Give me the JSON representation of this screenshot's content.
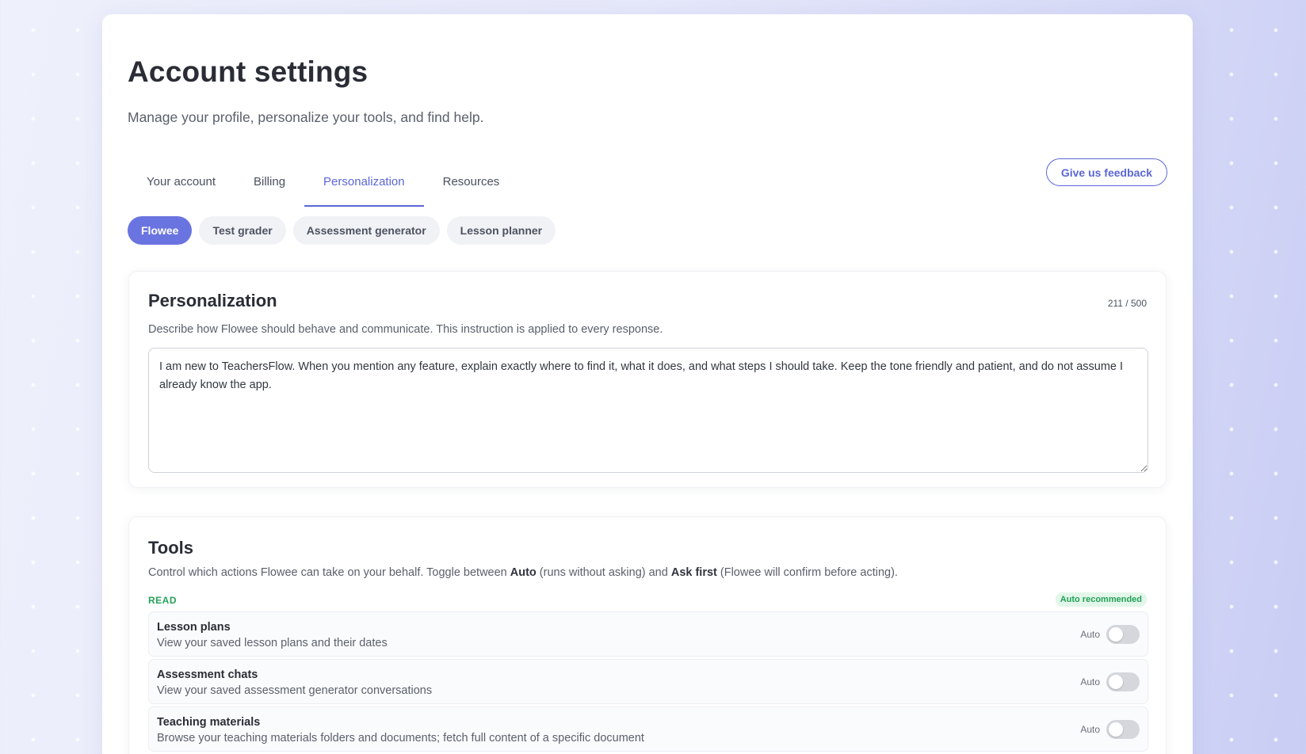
{
  "header": {
    "title": "Account settings",
    "subtitle": "Manage your profile, personalize your tools, and find help."
  },
  "tabs": [
    {
      "label": "Your account",
      "active": false
    },
    {
      "label": "Billing",
      "active": false
    },
    {
      "label": "Personalization",
      "active": true
    },
    {
      "label": "Resources",
      "active": false
    }
  ],
  "feedback_label": "Give us feedback",
  "pills": [
    {
      "label": "Flowee",
      "active": true
    },
    {
      "label": "Test grader",
      "active": false
    },
    {
      "label": "Assessment generator",
      "active": false
    },
    {
      "label": "Lesson planner",
      "active": false
    }
  ],
  "personalization": {
    "title": "Personalization",
    "char_count": "211 / 500",
    "description": "Describe how Flowee should behave and communicate. This instruction is applied to every response.",
    "instruction": "I am new to TeachersFlow. When you mention any feature, explain exactly where to find it, what it does, and what steps I should take. Keep the tone friendly and patient, and do not assume I already know the app."
  },
  "tools": {
    "title": "Tools",
    "desc_part1": "Control which actions Flowee can take on your behalf. Toggle between ",
    "desc_auto": "Auto",
    "desc_part2": " (runs without asking) and ",
    "desc_ask": "Ask first",
    "desc_part3": " (Flowee will confirm before acting).",
    "read_label": "READ",
    "auto_badge": "Auto recommended",
    "items": [
      {
        "name": "Lesson plans",
        "desc": "View your saved lesson plans and their dates",
        "mode": "Auto"
      },
      {
        "name": "Assessment chats",
        "desc": "View your saved assessment generator conversations",
        "mode": "Auto"
      },
      {
        "name": "Teaching materials",
        "desc": "Browse your teaching materials folders and documents; fetch full content of a specific document",
        "mode": "Auto"
      }
    ]
  },
  "colors": {
    "accent": "#5b67d6",
    "accent_pill": "#6a74e0",
    "green": "#22a157"
  }
}
